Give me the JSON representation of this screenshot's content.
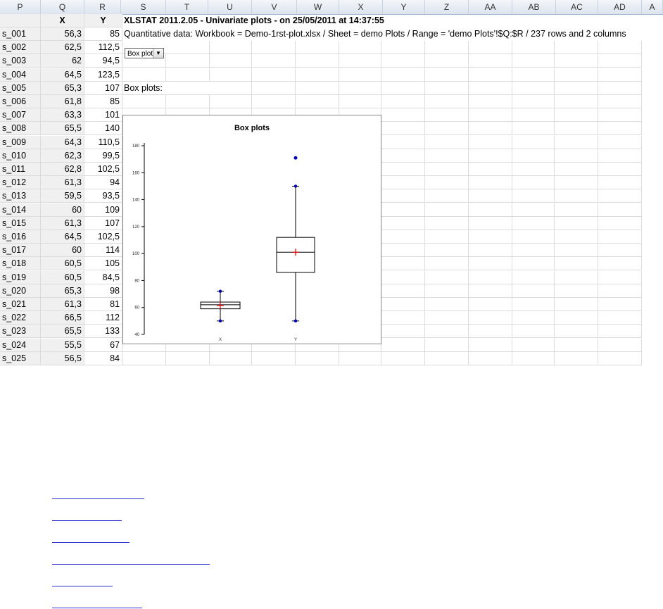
{
  "columns": [
    "P",
    "Q",
    "R",
    "S",
    "T",
    "U",
    "V",
    "W",
    "X",
    "Y",
    "Z",
    "AA",
    "AB",
    "AC",
    "AD",
    "A"
  ],
  "table_header": {
    "x": "X",
    "y": "Y"
  },
  "rows": [
    {
      "id": "s_001",
      "x": "56,3",
      "y": "85"
    },
    {
      "id": "s_002",
      "x": "62,5",
      "y": "112,5"
    },
    {
      "id": "s_003",
      "x": "62",
      "y": "94,5"
    },
    {
      "id": "s_004",
      "x": "64,5",
      "y": "123,5"
    },
    {
      "id": "s_005",
      "x": "65,3",
      "y": "107"
    },
    {
      "id": "s_006",
      "x": "61,8",
      "y": "85"
    },
    {
      "id": "s_007",
      "x": "63,3",
      "y": "101"
    },
    {
      "id": "s_008",
      "x": "65,5",
      "y": "140"
    },
    {
      "id": "s_009",
      "x": "64,3",
      "y": "110,5"
    },
    {
      "id": "s_010",
      "x": "62,3",
      "y": "99,5"
    },
    {
      "id": "s_011",
      "x": "62,8",
      "y": "102,5"
    },
    {
      "id": "s_012",
      "x": "61,3",
      "y": "94"
    },
    {
      "id": "s_013",
      "x": "59,5",
      "y": "93,5"
    },
    {
      "id": "s_014",
      "x": "60",
      "y": "109"
    },
    {
      "id": "s_015",
      "x": "61,3",
      "y": "107"
    },
    {
      "id": "s_016",
      "x": "64,5",
      "y": "102,5"
    },
    {
      "id": "s_017",
      "x": "60",
      "y": "114"
    },
    {
      "id": "s_018",
      "x": "60,5",
      "y": "105"
    },
    {
      "id": "s_019",
      "x": "60,5",
      "y": "84,5"
    },
    {
      "id": "s_020",
      "x": "65,3",
      "y": "98"
    },
    {
      "id": "s_021",
      "x": "61,3",
      "y": "81"
    },
    {
      "id": "s_022",
      "x": "66,5",
      "y": "112"
    },
    {
      "id": "s_023",
      "x": "65,5",
      "y": "133"
    },
    {
      "id": "s_024",
      "x": "55,5",
      "y": "67"
    },
    {
      "id": "s_025",
      "x": "56,5",
      "y": "84"
    }
  ],
  "report": {
    "title": "XLSTAT 2011.2.05 - Univariate plots - on 25/05/2011 at 14:37:55",
    "quant_line": "Quantitative data: Workbook = Demo-1rst-plot.xlsx / Sheet = demo Plots / Range = 'demo Plots'!$Q:$R / 237 rows and 2 columns",
    "dropdown_value": "Box plot",
    "section_label": "Box plots:"
  },
  "chart_data": {
    "type": "boxplot",
    "title": "Box plots",
    "categories": [
      "X",
      "Y"
    ],
    "ylim": [
      40,
      180
    ],
    "yticks": [
      40,
      60,
      80,
      100,
      120,
      140,
      160,
      180
    ],
    "boxes": [
      {
        "name": "X",
        "min": 50,
        "q1": 59,
        "median": 62,
        "q3": 64,
        "max": 72,
        "mean": 61.5,
        "outliers": []
      },
      {
        "name": "Y",
        "min": 50,
        "q1": 86,
        "median": 101,
        "q3": 112,
        "max": 150,
        "mean": 101,
        "outliers": [
          171
        ]
      }
    ],
    "colors": {
      "mean": "#e00000",
      "extreme": "#0000b0",
      "box": "#000000"
    }
  }
}
